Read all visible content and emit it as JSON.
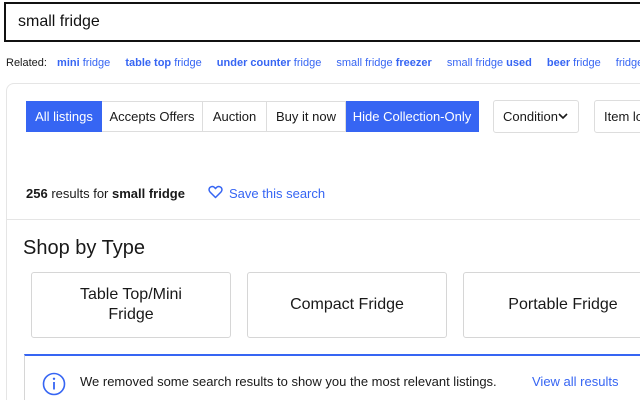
{
  "search": {
    "value": "small fridge"
  },
  "related": {
    "label": "Related:",
    "items": [
      {
        "pre": "",
        "bold": "mini",
        "post": " fridge"
      },
      {
        "pre": "",
        "bold": "table top",
        "post": " fridge"
      },
      {
        "pre": "",
        "bold": "under counter",
        "post": " fridge"
      },
      {
        "pre": "small fridge ",
        "bold": "freezer",
        "post": ""
      },
      {
        "pre": "small fridge ",
        "bold": "used",
        "post": ""
      },
      {
        "pre": "",
        "bold": "beer",
        "post": " fridge"
      },
      {
        "pre": "",
        "bold": "",
        "post": "fridge"
      }
    ]
  },
  "filters": {
    "all": "All listings",
    "offers": "Accepts Offers",
    "auction": "Auction",
    "buy_now": "Buy it now",
    "hide_collection": "Hide Collection-Only",
    "condition": "Condition",
    "location": "Item lo"
  },
  "results": {
    "count": "256",
    "mid": " results for ",
    "query": "small fridge",
    "save": "Save this search"
  },
  "shop_by_type": {
    "title": "Shop by Type",
    "cards": [
      "Table Top/Mini Fridge",
      "Compact Fridge",
      "Portable Fridge"
    ]
  },
  "notice": {
    "text": "We removed some search results to show you the most relevant listings.",
    "link": "View all results"
  },
  "colors": {
    "accent": "#3665f3",
    "text": "#191919",
    "border": "#dddddd"
  }
}
